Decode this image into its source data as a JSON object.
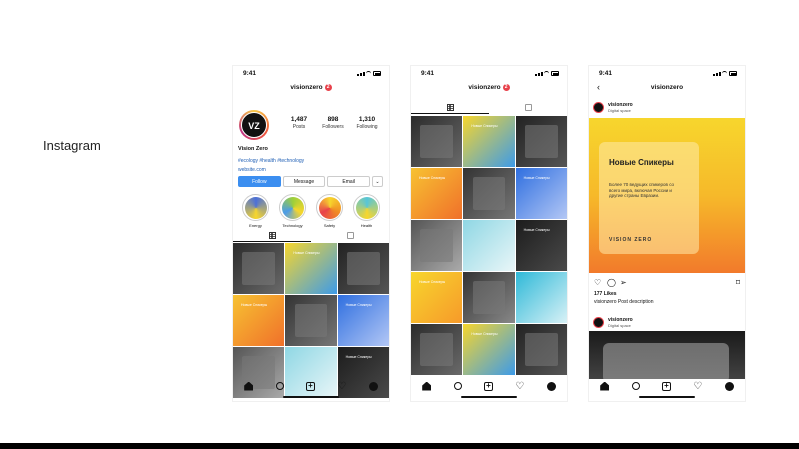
{
  "slide_label": "Instagram",
  "status": {
    "time": "9:41"
  },
  "profile_screen": {
    "username": "visionzero",
    "badge": "2",
    "avatar_text": "VZ",
    "stats": [
      {
        "value": "1,487",
        "label": "Posts"
      },
      {
        "value": "898",
        "label": "Followers"
      },
      {
        "value": "1,310",
        "label": "Following"
      }
    ],
    "display_name": "Vision Zero",
    "hashtags": "#ecology #health #technology",
    "website": "website.com",
    "buttons": {
      "follow": "Follow",
      "message": "Message",
      "email": "Email",
      "more": "⌄"
    },
    "highlights": [
      {
        "label": "Energy",
        "color": "#4b6fd8"
      },
      {
        "label": "Technology",
        "color": "#9ccf3a"
      },
      {
        "label": "Safety",
        "color": "#f08a24"
      },
      {
        "label": "Health",
        "color": "#56c5d8"
      }
    ]
  },
  "grid_screen": {
    "username": "visionzero"
  },
  "post_screen": {
    "title": "visionzero",
    "author": "visionzero",
    "author_sub": "Digital space",
    "post_title": "Новые Спикеры",
    "post_desc": "Более 70 ведущих спикеров со всего мира, включая России и другие страны Евразии.",
    "post_logo": "VISION ZERO",
    "likes": "177 Likes",
    "caption": "visionzero Post description",
    "second_author": "visionzero",
    "second_sub": "Digital space"
  },
  "grid_tiles": [
    "linear-gradient(135deg,#2b2b2b,#6a6a6a)",
    "linear-gradient(135deg,#f7d62d,#3d9be9)",
    "linear-gradient(135deg,#222,#555)",
    "linear-gradient(135deg,#f7c232,#f0702a)",
    "linear-gradient(135deg,#333,#777)",
    "linear-gradient(135deg,#2f6fe0,#b3c7f5)",
    "linear-gradient(135deg,#555,#aaa)",
    "linear-gradient(135deg,#8fd7e4,#e9f6f8)",
    "linear-gradient(135deg,#1c1c1c,#4a4a4a)",
    "linear-gradient(135deg,#f7d62d,#f79a2a)",
    "linear-gradient(135deg,#333,#888)",
    "linear-gradient(135deg,#2fb9d8,#d8f1f6)"
  ],
  "tile_text": "Новые Спикеры"
}
